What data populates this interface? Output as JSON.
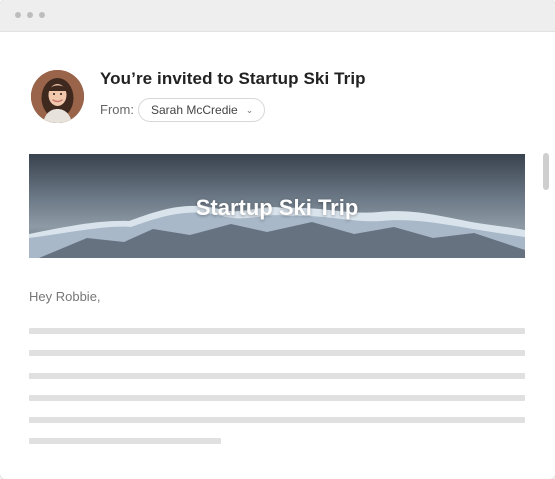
{
  "email": {
    "subject": "You’re invited to Startup Ski Trip",
    "from_label": "From:",
    "from_name": "Sarah McCredie",
    "banner_title": "Startup Ski Trip",
    "greeting": "Hey Robbie,"
  },
  "icons": {
    "from_dropdown": "chevron-down-icon"
  }
}
